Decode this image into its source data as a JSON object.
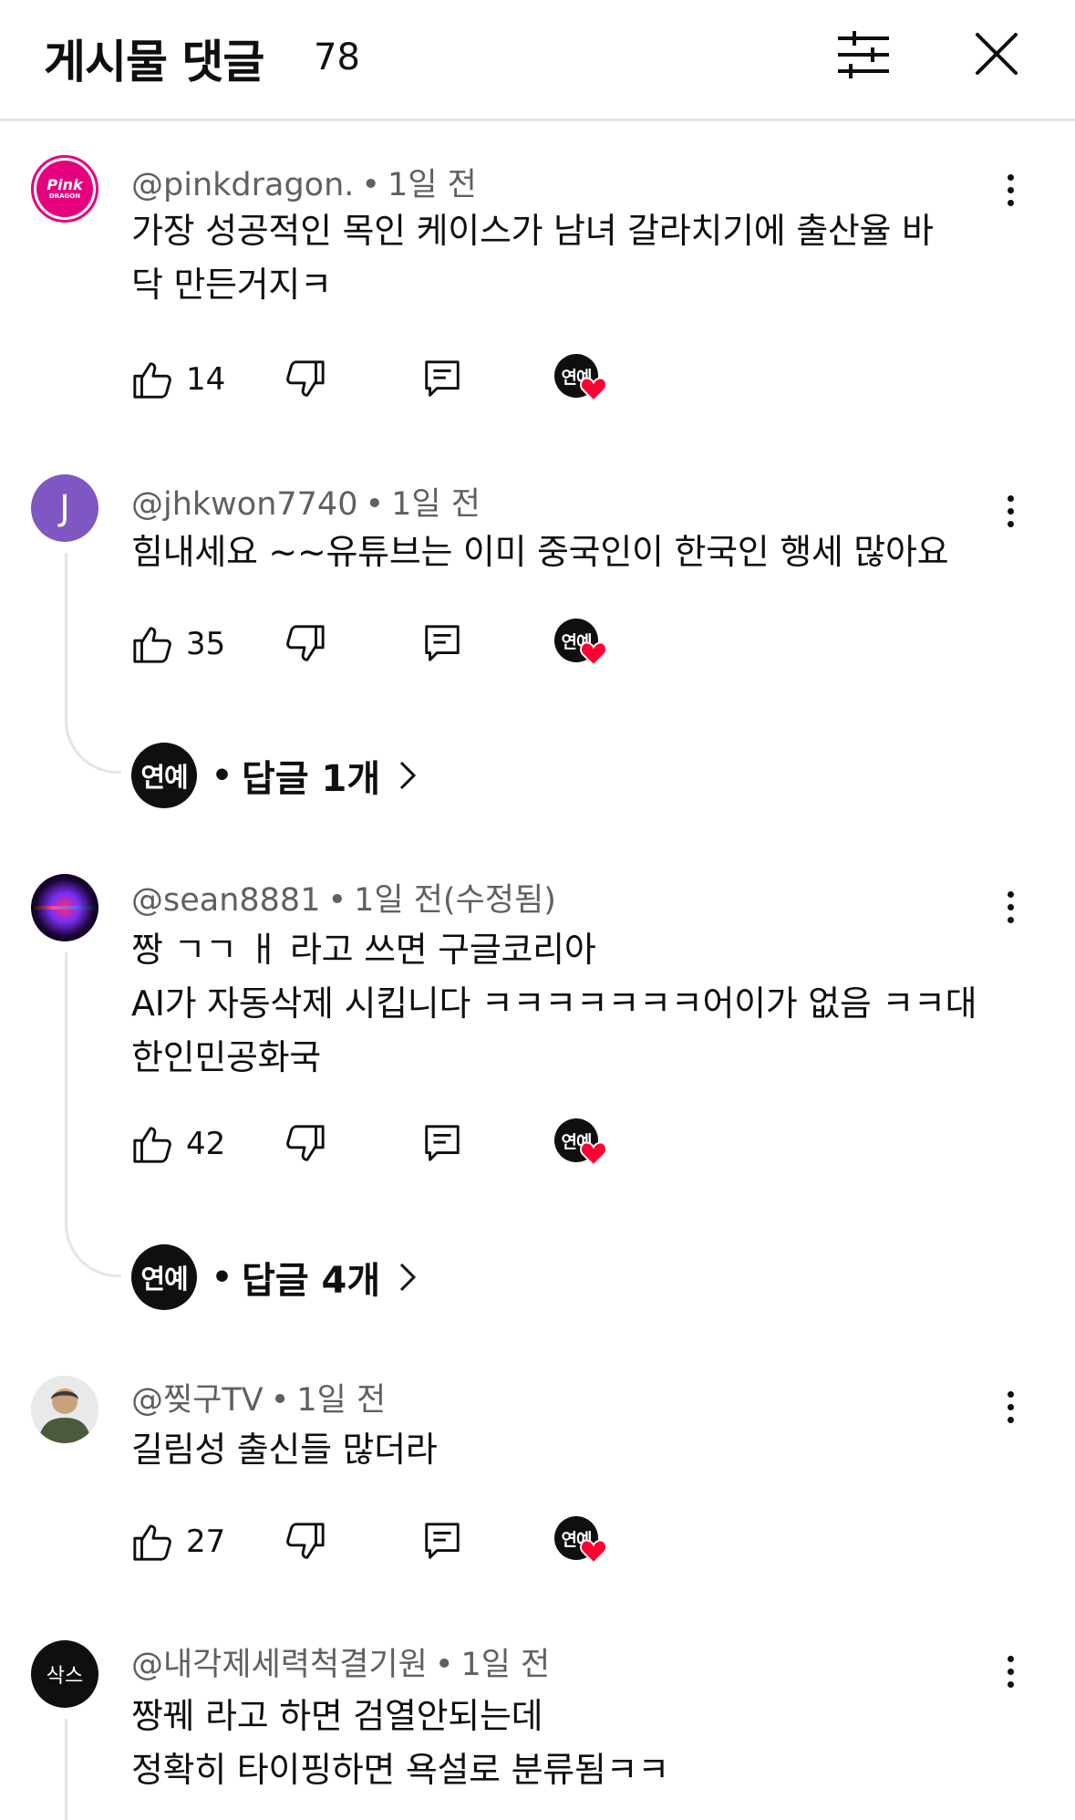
{
  "header": {
    "title": "게시물 댓글",
    "count": "78"
  },
  "comments": [
    {
      "author": "@pinkdragon.",
      "time": "1일 전",
      "text": "가장 성공적인 목인 케이스가 남녀 갈라치기에 출산율 바\n닥 만든거지ㅋ",
      "likes": "14",
      "avatar_text": "Pink",
      "avatar_sub": "DRAGON",
      "creator_badge": "연예"
    },
    {
      "author": "@jhkwon7740",
      "time": "1일 전",
      "text": "힘내세요 ~~유튜브는 이미 중국인이 한국인 행세 많아요",
      "likes": "35",
      "avatar_text": "J",
      "creator_badge": "연예",
      "reply_avatar": "연예",
      "reply_label": "답글 1개"
    },
    {
      "author": "@sean8881",
      "time": "1일 전(수정됨)",
      "text": "짱 ㄱㄱ ㅐ 라고 쓰면 구글코리아\nAI가 자동삭제 시킵니다 ㅋㅋㅋㅋㅋㅋㅋ어이가 없음 ㅋㅋ대\n한인민공화국",
      "likes": "42",
      "creator_badge": "연예",
      "reply_avatar": "연예",
      "reply_label": "답글 4개"
    },
    {
      "author": "@찢구TV",
      "time": "1일 전",
      "text": "길림성 출신들 많더라",
      "likes": "27",
      "creator_badge": "연예"
    },
    {
      "author": "@내각제세력척결기원",
      "time": "1일 전",
      "text": "짱꿰 라고 하면 검열안되는데\n정확히 타이핑하면 욕설로 분류됨ㅋㅋ",
      "avatar_text": "삭스"
    }
  ],
  "colors": {
    "accent_heart": "#ff0033",
    "pink_avatar": "#e6007e",
    "purple_avatar": "#7e57c2"
  }
}
